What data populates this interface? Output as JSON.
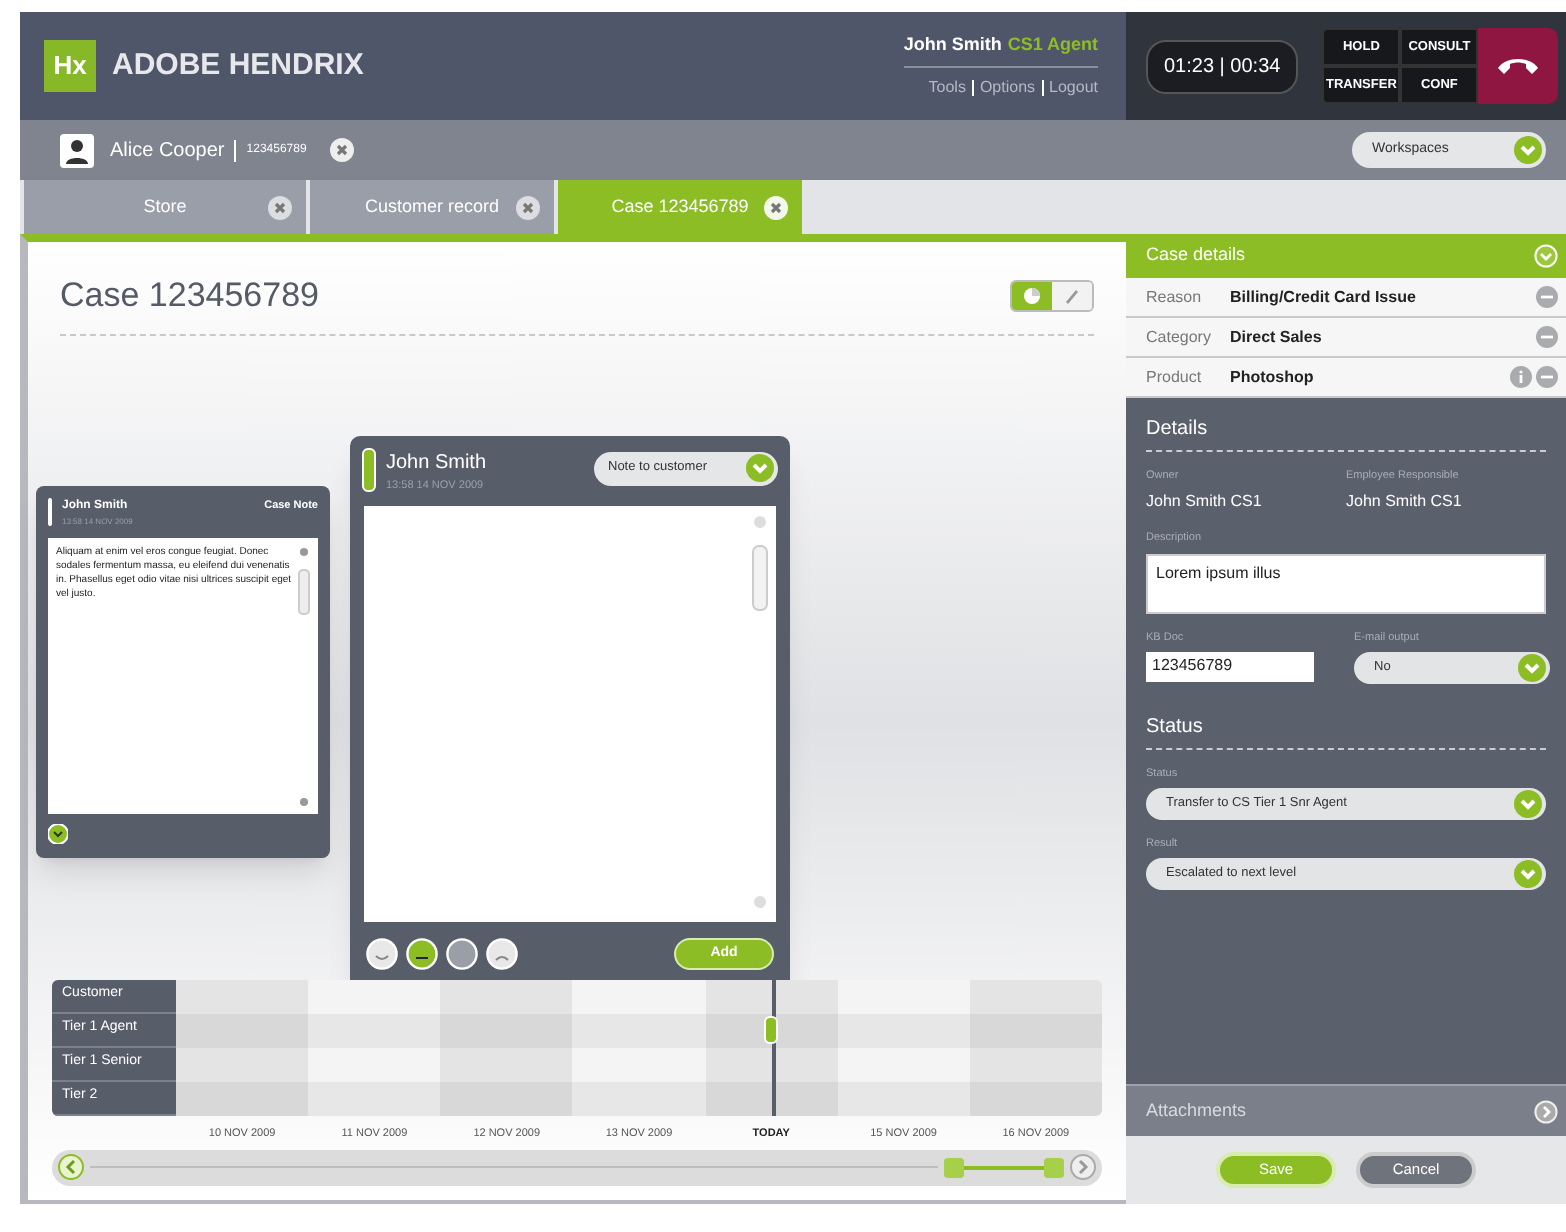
{
  "app": {
    "logo": "Hx",
    "title": "ADOBE HENDRIX"
  },
  "user": {
    "name": "John Smith",
    "role": "CS1 Agent",
    "links": [
      "Tools",
      "Options",
      "Logout"
    ]
  },
  "call": {
    "timer": "01:23 | 00:34",
    "buttons": [
      "HOLD",
      "CONSULT",
      "TRANSFER",
      "CONF"
    ]
  },
  "customer": {
    "name": "Alice Cooper",
    "id": "123456789"
  },
  "workspaces": "Workspaces",
  "tabs": [
    {
      "label": "Store",
      "selected": false
    },
    {
      "label": "Customer record",
      "selected": false
    },
    {
      "label": "Case 123456789",
      "selected": true
    }
  ],
  "case_title": "Case 123456789",
  "view_modes": [
    {
      "kind": "chart",
      "selected": true
    },
    {
      "kind": "edit",
      "selected": false
    }
  ],
  "notes": [
    {
      "kind": "compact",
      "author": "John Smith",
      "time": "13:58 14 NOV 2009",
      "type": "Case Note",
      "body": "Aliquam at enim vel eros congue feugiat. Donec sodales fermentum massa, eu eleifend dui venenatis in. Phasellus eget odio vitae nisi ultrices suscipit eget vel justo."
    },
    {
      "kind": "editor",
      "author": "John Smith",
      "time": "13:58 14 NOV 2009",
      "type": "Note to customer",
      "action": "Add",
      "moods": [
        {
          "kind": "happy",
          "selected": false
        },
        {
          "kind": "neutral",
          "selected": true
        },
        {
          "kind": "blank",
          "selected": false
        },
        {
          "kind": "sad",
          "selected": false
        }
      ]
    }
  ],
  "timeline": {
    "rows": [
      {
        "label": "Customer",
        "has_event": false
      },
      {
        "label": "Tier 1 Agent",
        "has_event": true
      },
      {
        "label": "Tier 1 Senior",
        "has_event": false
      },
      {
        "label": "Tier 2",
        "has_event": false
      }
    ],
    "dates": [
      {
        "label": "10 NOV 2009",
        "today": false
      },
      {
        "label": "11 NOV 2009",
        "today": false
      },
      {
        "label": "12 NOV 2009",
        "today": false
      },
      {
        "label": "13 NOV 2009",
        "today": false
      },
      {
        "label": "TODAY",
        "today": true
      },
      {
        "label": "15 NOV 2009",
        "today": false
      },
      {
        "label": "16 NOV 2009",
        "today": false
      }
    ]
  },
  "case_details": {
    "title": "Case details",
    "fields": [
      {
        "label": "Reason",
        "value": "Billing/Credit Card Issue",
        "info": false
      },
      {
        "label": "Category",
        "value": "Direct Sales",
        "info": false
      },
      {
        "label": "Product",
        "value": "Photoshop",
        "info": true
      }
    ]
  },
  "details": {
    "title": "Details",
    "owner": {
      "label": "Owner",
      "value": "John Smith CS1"
    },
    "employee": {
      "label": "Employee Responsible",
      "value": "John Smith CS1"
    },
    "description": {
      "label": "Description",
      "value": "Lorem ipsum illus"
    },
    "kb_doc": {
      "label": "KB Doc",
      "value": "123456789"
    },
    "email_output": {
      "label": "E-mail output",
      "value": "No"
    }
  },
  "status": {
    "title": "Status",
    "status": {
      "label": "Status",
      "value": "Transfer to CS Tier 1 Snr Agent"
    },
    "result": {
      "label": "Result",
      "value": "Escalated to next level"
    }
  },
  "attachments": "Attachments",
  "buttons": [
    {
      "label": "Save",
      "kind": "primary"
    },
    {
      "label": "Cancel",
      "kind": "secondary"
    }
  ]
}
